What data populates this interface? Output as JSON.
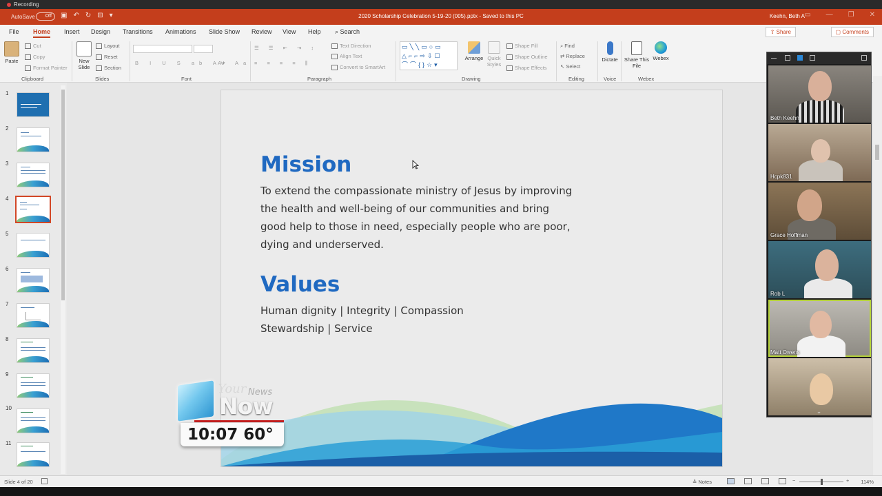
{
  "recording": {
    "label": "Recording"
  },
  "titlebar": {
    "autosave": "AutoSave",
    "autosave_state": "Off",
    "document_title": "2020 Scholarship Celebration 5-19-20 (005).pptx  -  Saved to this PC",
    "user": "Keehn, Beth A"
  },
  "tabs": [
    "File",
    "Home",
    "Insert",
    "Design",
    "Transitions",
    "Animations",
    "Slide Show",
    "Review",
    "View",
    "Help"
  ],
  "active_tab": "Home",
  "search": {
    "label": "Search"
  },
  "share": {
    "label": "Share"
  },
  "comments": {
    "label": "Comments"
  },
  "ribbon": {
    "clipboard": {
      "label": "Clipboard",
      "paste": "Paste",
      "cut": "Cut",
      "copy": "Copy",
      "format_painter": "Format Painter"
    },
    "slides": {
      "label": "Slides",
      "new_slide": "New Slide",
      "layout": "Layout",
      "reset": "Reset",
      "section": "Section"
    },
    "font": {
      "label": "Font"
    },
    "paragraph": {
      "label": "Paragraph",
      "text_direction": "Text Direction",
      "align_text": "Align Text",
      "convert_smartart": "Convert to SmartArt"
    },
    "drawing": {
      "label": "Drawing",
      "arrange": "Arrange",
      "quick_styles": "Quick Styles",
      "shape_fill": "Shape Fill",
      "shape_outline": "Shape Outline",
      "shape_effects": "Shape Effects"
    },
    "editing": {
      "label": "Editing",
      "find": "Find",
      "replace": "Replace",
      "select": "Select"
    },
    "voice": {
      "label": "Voice",
      "dictate": "Dictate"
    },
    "webex": {
      "label": "Webex",
      "share_file": "Share This File",
      "webex": "Webex"
    }
  },
  "thumbnails": {
    "numbers": [
      "1",
      "2",
      "3",
      "4",
      "5",
      "6",
      "7",
      "8",
      "9",
      "10",
      "11"
    ],
    "selected": "4"
  },
  "slide": {
    "mission_title": "Mission",
    "mission_text": "To extend the compassionate ministry of Jesus by improving the health and well-being of our communities and bring good help to those in need, especially people who are poor, dying and underserved.",
    "values_title": "Values",
    "values_line1": "Human dignity | Integrity | Compassion",
    "values_line2": "Stewardship | Service"
  },
  "participants": [
    {
      "name": "Beth Keehn"
    },
    {
      "name": "Hcpk831"
    },
    {
      "name": "Grace Hoffman"
    },
    {
      "name": "Rob L"
    },
    {
      "name": "Matt Owens",
      "active": true
    },
    {
      "name": ""
    }
  ],
  "news": {
    "your": "Your",
    "news": "News",
    "now": "Now",
    "time_temp": "10:07 60°"
  },
  "statusbar": {
    "slide_info": "Slide 4 of 20",
    "notes": "Notes",
    "zoom": "114%"
  },
  "colors": {
    "brand": "#c43e1c",
    "heading": "#1f69c1",
    "active_speaker": "#b6d33a"
  }
}
